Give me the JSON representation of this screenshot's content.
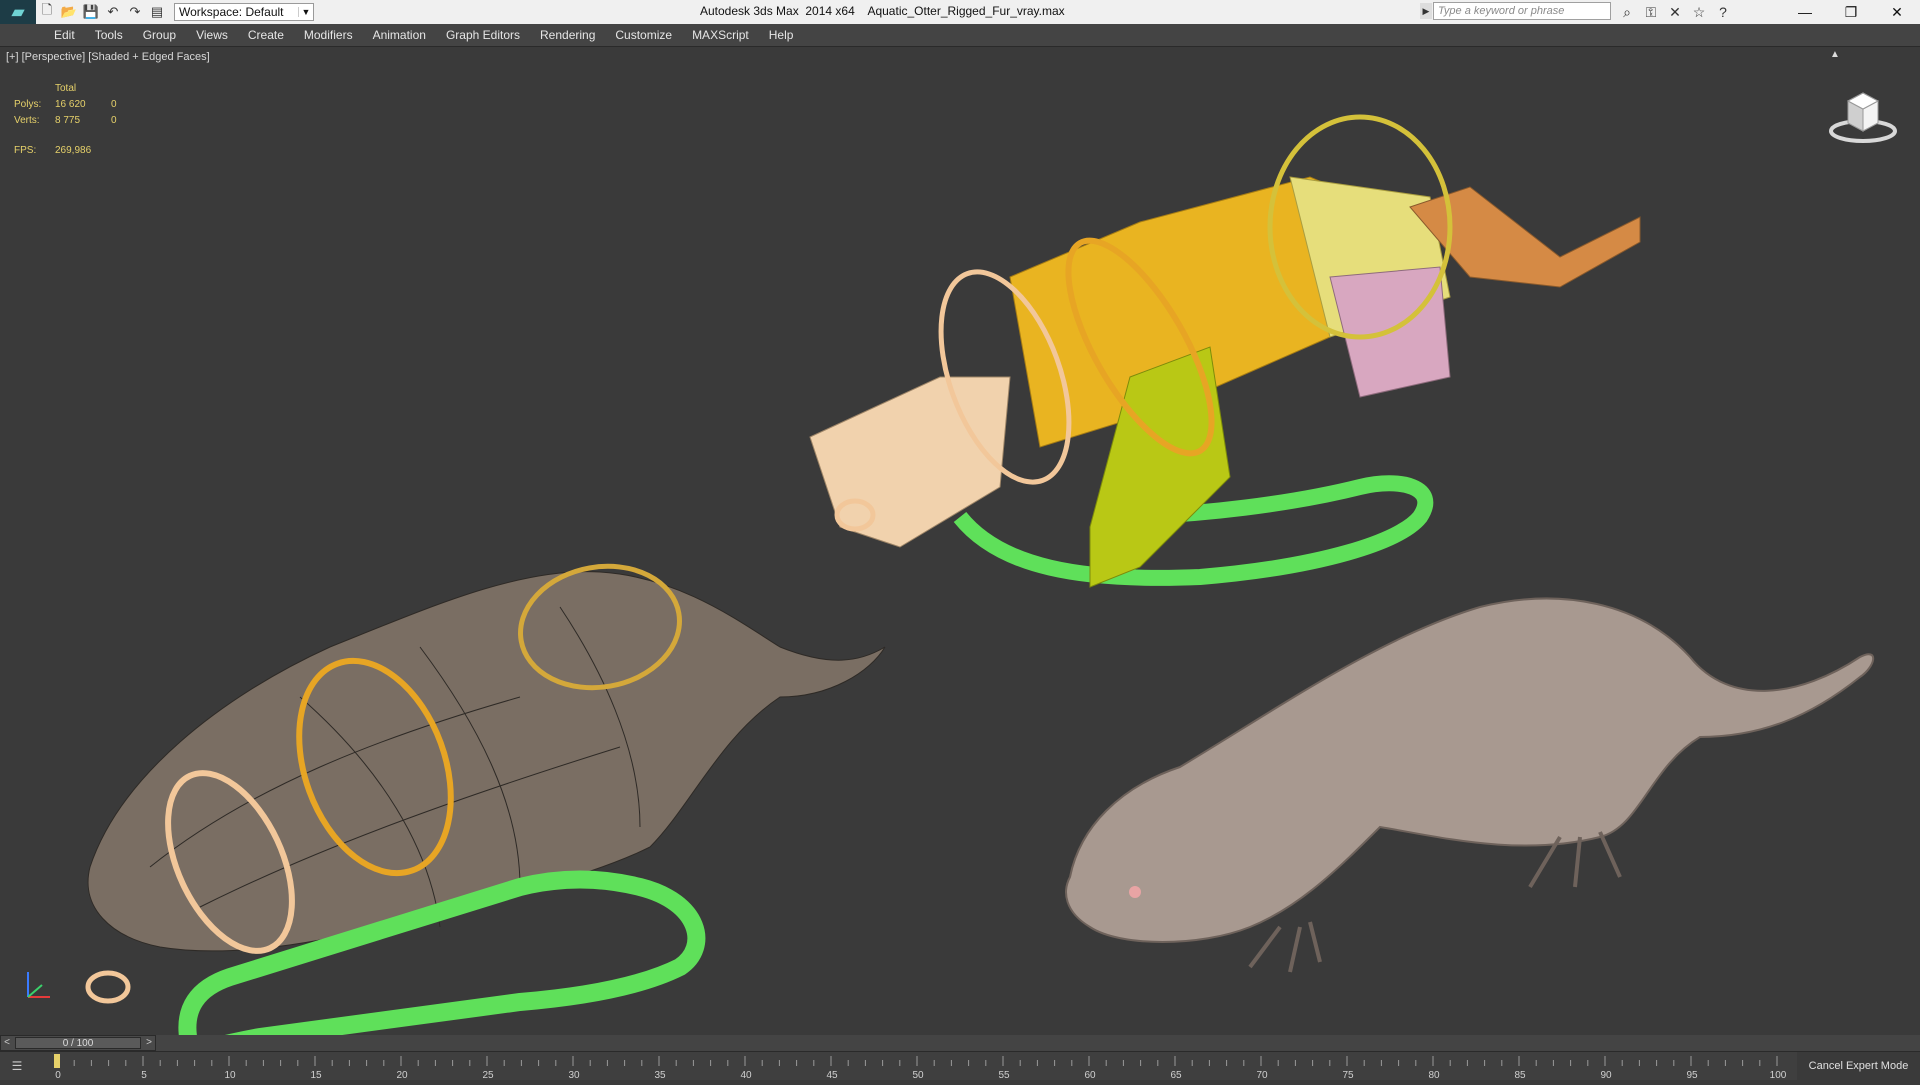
{
  "titlebar": {
    "app_title": "Autodesk 3ds Max  2014 x64",
    "file_name": "Aquatic_Otter_Rigged_Fur_vray.max",
    "workspace_label": "Workspace: Default",
    "search_placeholder": "Type a keyword or phrase"
  },
  "menu": [
    "Edit",
    "Tools",
    "Group",
    "Views",
    "Create",
    "Modifiers",
    "Animation",
    "Graph Editors",
    "Rendering",
    "Customize",
    "MAXScript",
    "Help"
  ],
  "viewport": {
    "label": "[+] [Perspective] [Shaded + Edged Faces]",
    "stats": {
      "header": "Total",
      "polys_label": "Polys:",
      "polys_total": "16 620",
      "polys_sel": "0",
      "verts_label": "Verts:",
      "verts_total": "8 775",
      "verts_sel": "0",
      "fps_label": "FPS:",
      "fps_value": "269,986"
    }
  },
  "timeline": {
    "frame_display": "0 / 100",
    "ticks": [
      "0",
      "5",
      "10",
      "15",
      "20",
      "25",
      "30",
      "35",
      "40",
      "45",
      "50",
      "55",
      "60",
      "65",
      "70",
      "75",
      "80",
      "85",
      "90",
      "95",
      "100"
    ],
    "cancel_expert_mode": "Cancel Expert Mode"
  },
  "colors": {
    "viewport_bg": "#3a3a3a",
    "stats_text": "#e6d16a",
    "control_green": "#5fe05a",
    "ring_orange": "#e3a32a"
  }
}
